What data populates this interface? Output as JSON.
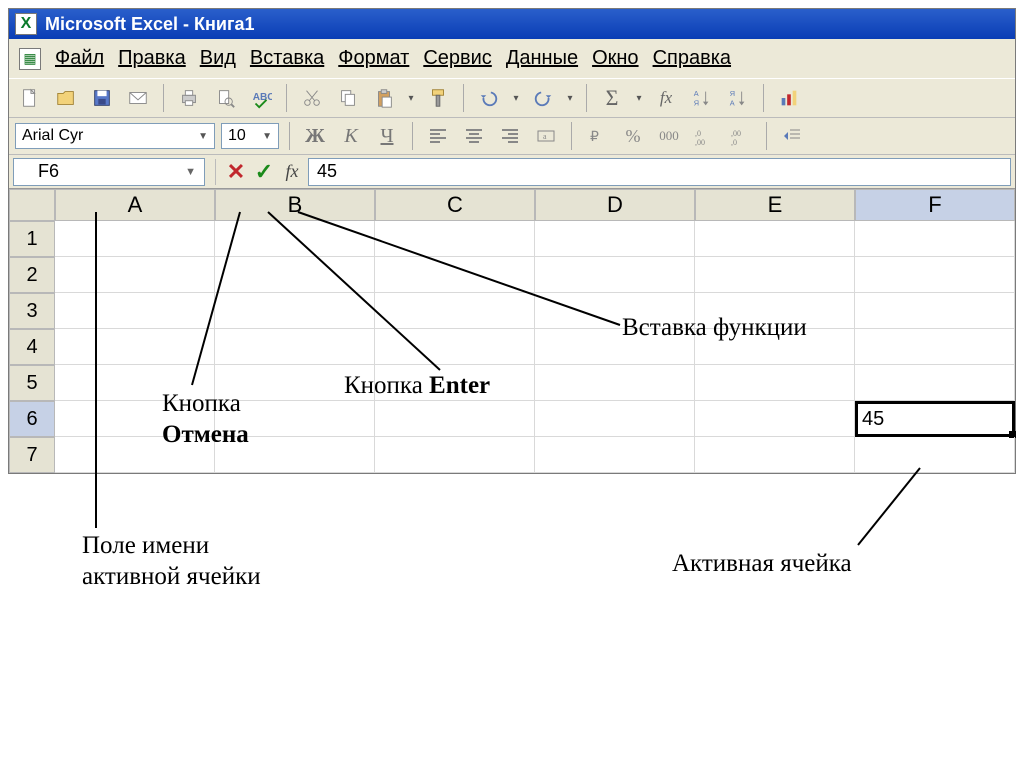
{
  "title": "Microsoft Excel - Книга1",
  "menu": {
    "file": "Файл",
    "edit": "Правка",
    "view": "Вид",
    "insert": "Вставка",
    "format": "Формат",
    "tools": "Сервис",
    "data": "Данные",
    "window": "Окно",
    "help": "Справка"
  },
  "format_bar": {
    "font_name": "Arial Cyr",
    "font_size": "10",
    "bold": "Ж",
    "italic": "К",
    "underline": "Ч",
    "currency": "%",
    "thousands": "000"
  },
  "formula_bar": {
    "name_box": "F6",
    "cancel_glyph": "✕",
    "enter_glyph": "✓",
    "fx_glyph": "fx",
    "value": "45"
  },
  "grid": {
    "columns": [
      "A",
      "B",
      "C",
      "D",
      "E",
      "F"
    ],
    "rows": [
      "1",
      "2",
      "3",
      "4",
      "5",
      "6",
      "7"
    ],
    "active_col": "F",
    "active_row": "6",
    "active_cell_value": "45"
  },
  "annotations": {
    "name_box_label": "Поле имени\nактивной ячейки",
    "cancel_label_line1": "Кнопка",
    "cancel_label_line2": "Отмена",
    "enter_label_pre": "Кнопка ",
    "enter_label_bold": "Enter",
    "fx_label": "Вставка функции",
    "active_cell_label": "Активная ячейка"
  },
  "toolbar_icons": {
    "sigma": "Σ",
    "fx": "fx"
  }
}
